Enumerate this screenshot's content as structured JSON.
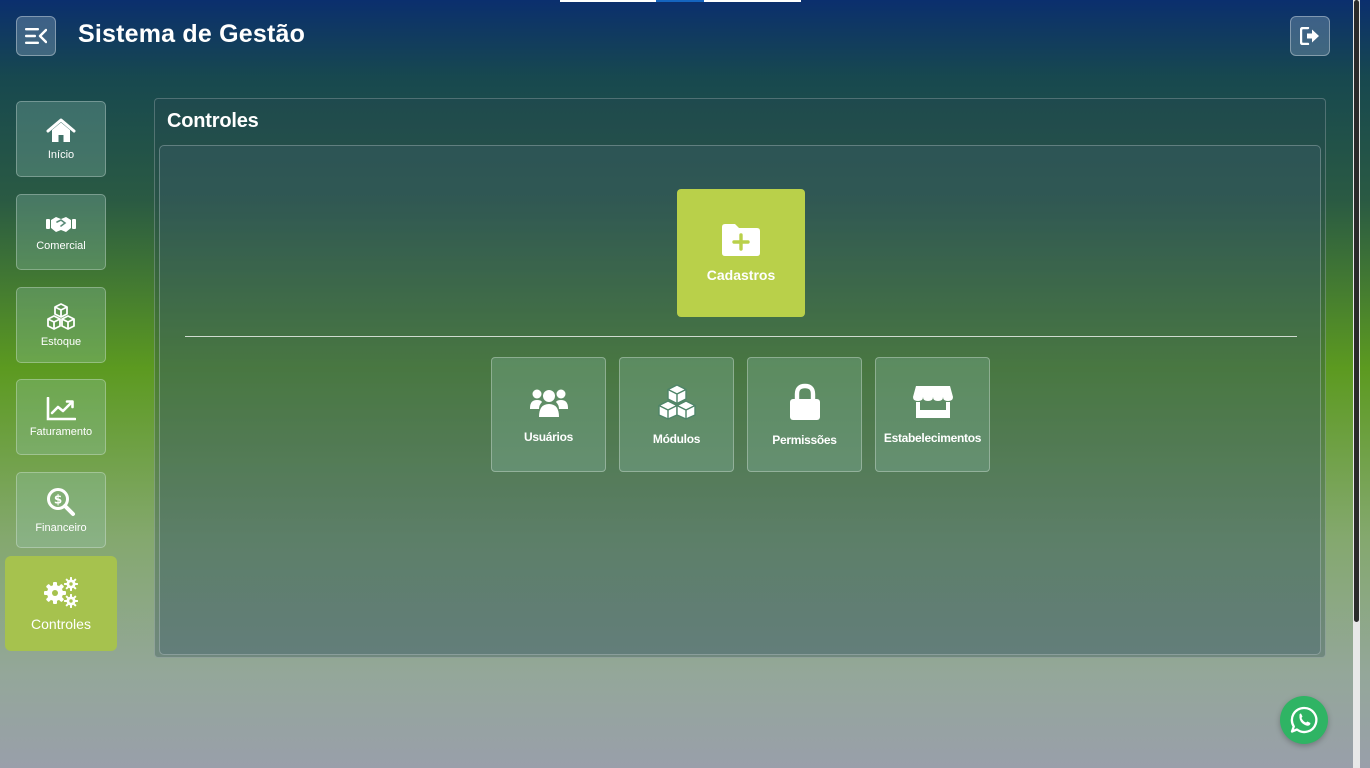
{
  "header": {
    "title": "Sistema de Gestão",
    "menu_icon": "menu-collapse-icon",
    "logout_icon": "logout-icon"
  },
  "colors": {
    "accent": "#b9d04a",
    "active_sidebar": "#a6c24e",
    "whatsapp": "#2fb464",
    "top_strip": [
      "#ffffff",
      "#1565c0",
      "#ffffff"
    ]
  },
  "sidebar": {
    "items": [
      {
        "label": "Início",
        "icon": "home-icon"
      },
      {
        "label": "Comercial",
        "icon": "handshake-icon"
      },
      {
        "label": "Estoque",
        "icon": "cubes-icon"
      },
      {
        "label": "Faturamento",
        "icon": "chart-line-icon"
      },
      {
        "label": "Financeiro",
        "icon": "search-dollar-icon"
      },
      {
        "label": "Controles",
        "icon": "gears-icon",
        "active": true
      }
    ]
  },
  "main": {
    "title": "Controles",
    "primary": {
      "label": "Cadastros",
      "icon": "folder-plus-icon"
    },
    "tiles": [
      {
        "label": "Usuários",
        "icon": "users-icon"
      },
      {
        "label": "Módulos",
        "icon": "cubes-icon"
      },
      {
        "label": "Permissões",
        "icon": "lock-icon"
      },
      {
        "label": "Estabelecimentos",
        "icon": "store-icon"
      }
    ]
  },
  "whatsapp": {
    "icon": "whatsapp-icon"
  }
}
